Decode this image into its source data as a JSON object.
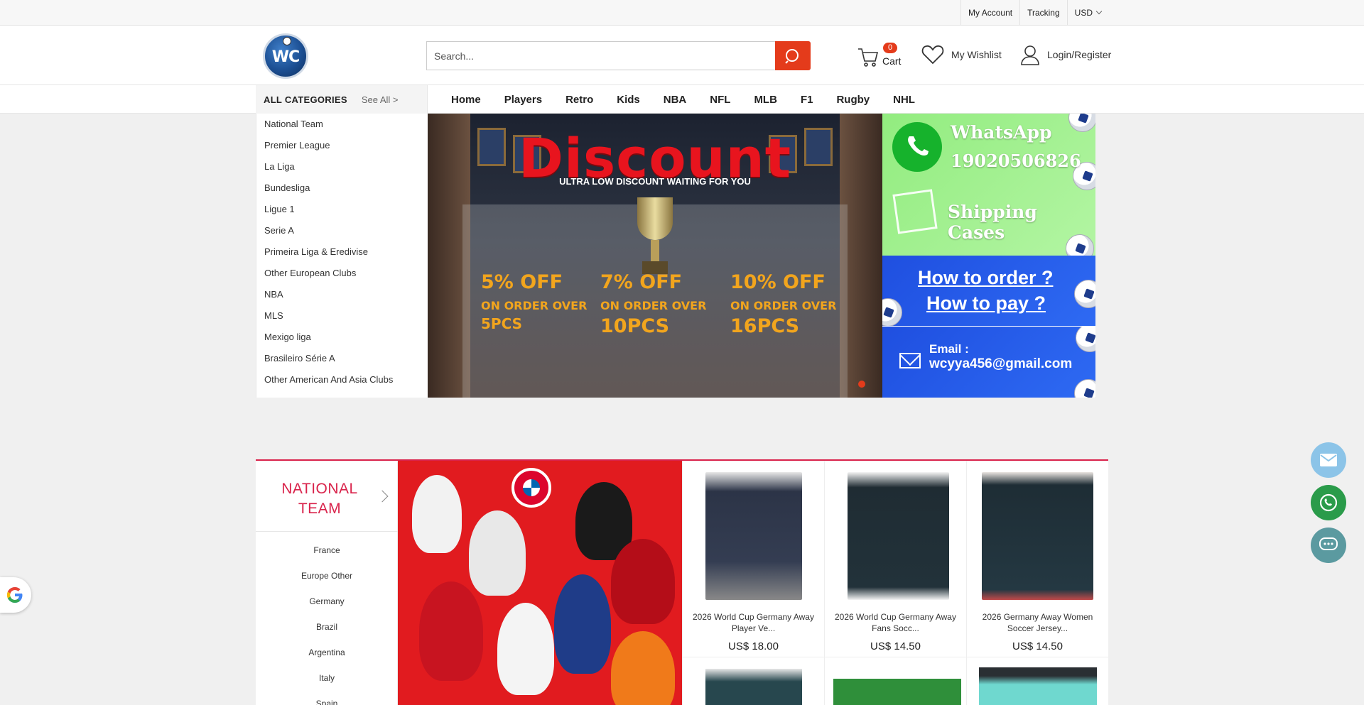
{
  "topbar": {
    "my_account": "My Account",
    "tracking": "Tracking",
    "currency": "USD"
  },
  "header": {
    "logo_text": "WC",
    "search_placeholder": "Search...",
    "cart_count": "0",
    "cart_label": "Cart",
    "wishlist_label": "My Wishlist",
    "login_label": "Login/Register",
    "accent_color": "#e43b1b"
  },
  "nav": {
    "all_categories": "ALL CATEGORIES",
    "see_all": "See All >",
    "items": [
      "Home",
      "Players",
      "Retro",
      "Kids",
      "NBA",
      "NFL",
      "MLB",
      "F1",
      "Rugby",
      "NHL"
    ]
  },
  "categories": [
    "National Team",
    "Premier League",
    "La Liga",
    "Bundesliga",
    "Ligue 1",
    "Serie A",
    "Primeira Liga & Eredivise",
    "Other European Clubs",
    "NBA",
    "MLS",
    "Mexigo liga",
    "Brasileiro Série  A",
    "Other American And Asia Clubs"
  ],
  "banner": {
    "title": "Discount",
    "subtitle": "ULTRA LOW DISCOUNT WAITING FOR YOU",
    "offers": [
      {
        "pct": "5% OFF",
        "on": "ON ORDER OVER",
        "pcs": "5PCS"
      },
      {
        "pct": "7% OFF",
        "on": "ON ORDER OVER",
        "pcs": "10PCS"
      },
      {
        "pct": "10% OFF",
        "on": "ON ORDER OVER",
        "pcs": "16PCS"
      }
    ],
    "slide_index": 1
  },
  "promos": {
    "whatsapp_title": "WhatsApp",
    "whatsapp_number": "19020506826",
    "shipping": "Shipping Cases",
    "how_order": "How to order ?",
    "how_pay": "How to pay ?",
    "email_label": "Email :",
    "email": "wcyya456@gmail.com"
  },
  "section": {
    "title": "NATIONAL TEAM",
    "accent_color": "#d9234b",
    "teams": [
      "France",
      "Europe Other",
      "Germany",
      "Brazil",
      "Argentina",
      "Italy",
      "Spain"
    ],
    "products": [
      {
        "name": "2026 World Cup Germany Away Player Ve...",
        "price": "US$ 18.00"
      },
      {
        "name": "2026 World Cup Germany Away Fans Socc...",
        "price": "US$ 14.50"
      },
      {
        "name": "2026 Germany Away Women Soccer Jersey...",
        "price": "US$ 14.50"
      }
    ]
  },
  "widgets": [
    "email-icon",
    "whatsapp-icon",
    "chat-icon",
    "google-icon"
  ]
}
